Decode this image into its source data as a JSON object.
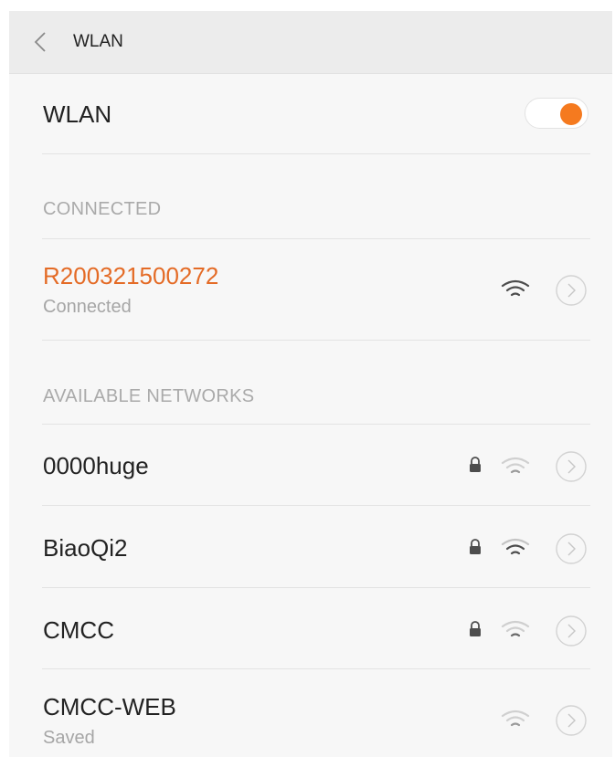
{
  "header": {
    "title": "WLAN",
    "back_icon": "chevron-left-icon"
  },
  "wlan_toggle": {
    "label": "WLAN",
    "state": "on",
    "accent_color": "#f57a1f"
  },
  "connected_section": {
    "label": "CONNECTED",
    "network": {
      "ssid": "R200321500272",
      "status": "Connected",
      "color": "#e46b26",
      "icons": [
        "wifi-icon",
        "info-chevron-icon"
      ]
    }
  },
  "available_section": {
    "label": "AVAILABLE NETWORKS",
    "networks": [
      {
        "ssid": "0000huge",
        "locked": true,
        "icons": [
          "lock-icon",
          "wifi-icon",
          "info-chevron-icon"
        ]
      },
      {
        "ssid": "BiaoQi2",
        "locked": true,
        "icons": [
          "lock-icon",
          "wifi-icon",
          "info-chevron-icon"
        ]
      },
      {
        "ssid": "CMCC",
        "locked": true,
        "icons": [
          "lock-icon",
          "wifi-icon",
          "info-chevron-icon"
        ]
      },
      {
        "ssid": "CMCC-WEB",
        "status": "Saved",
        "locked": false,
        "icons": [
          "wifi-icon",
          "info-chevron-icon"
        ]
      }
    ]
  }
}
